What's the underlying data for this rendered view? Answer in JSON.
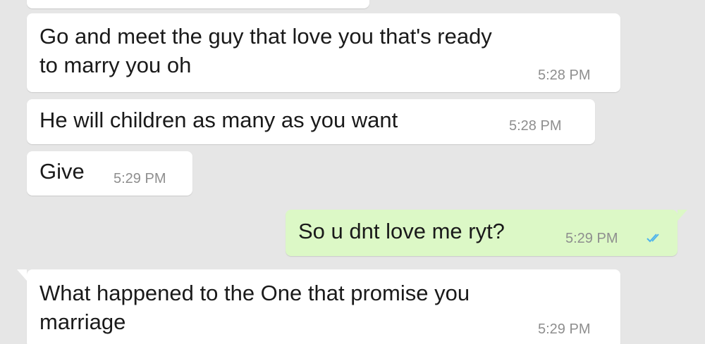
{
  "colors": {
    "background": "#e6e6e6",
    "incoming_bubble": "#ffffff",
    "outgoing_bubble": "#dcf8c6",
    "timestamp": "#8e8e8e",
    "read_ticks": "#4fb4ec"
  },
  "messages": [
    {
      "direction": "incoming",
      "line1": "",
      "line2": "",
      "time": ""
    },
    {
      "direction": "incoming",
      "line1": "Go and meet the guy that love you that's ready",
      "line2": "to marry you oh",
      "time": "5:28 PM"
    },
    {
      "direction": "incoming",
      "line1": "He will children as many as you want",
      "time": "5:28 PM"
    },
    {
      "direction": "incoming",
      "line1": "Give",
      "time": "5:29 PM"
    },
    {
      "direction": "outgoing",
      "line1": "So u dnt love me ryt?",
      "time": "5:29 PM",
      "status_icon": "double-check-read-icon"
    },
    {
      "direction": "incoming",
      "line1": "What happened to the One that promise you",
      "line2": "marriage",
      "time": "5:29 PM"
    }
  ]
}
